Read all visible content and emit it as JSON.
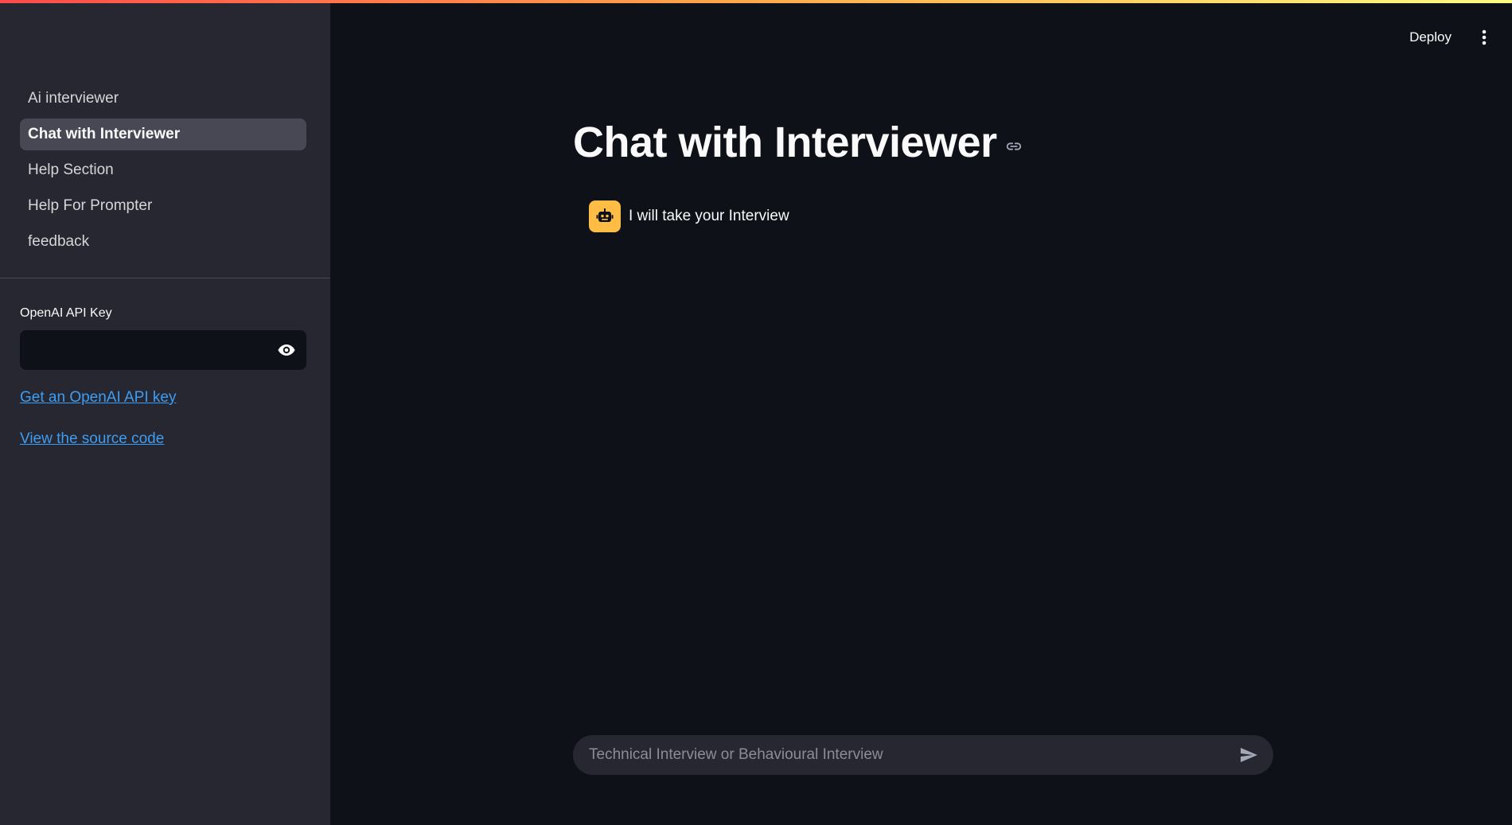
{
  "colors": {
    "background": "#0e1117",
    "sidebar": "#262730",
    "active_nav": "#474853",
    "link": "#3d9df3",
    "avatar": "#ffbd45"
  },
  "sidebar": {
    "nav": [
      {
        "label": "Ai interviewer",
        "active": false
      },
      {
        "label": "Chat with Interviewer",
        "active": true
      },
      {
        "label": "Help Section",
        "active": false
      },
      {
        "label": "Help For Prompter",
        "active": false
      },
      {
        "label": "feedback",
        "active": false
      }
    ],
    "api_key_label": "OpenAI API Key",
    "api_key_value": "",
    "api_key_toggle_icon": "eye-icon",
    "links": {
      "get_key": "Get an OpenAI API key",
      "source": "View the source code"
    }
  },
  "header": {
    "deploy_label": "Deploy",
    "menu_icon": "vertical-dots-icon"
  },
  "main": {
    "title": "Chat with Interviewer",
    "title_anchor_icon": "link-icon",
    "messages": [
      {
        "role": "assistant",
        "avatar_icon": "robot-icon",
        "text": "I will take your Interview"
      }
    ],
    "chat_input": {
      "placeholder": "Technical Interview or Behavioural Interview",
      "value": "",
      "send_icon": "send-icon"
    }
  }
}
